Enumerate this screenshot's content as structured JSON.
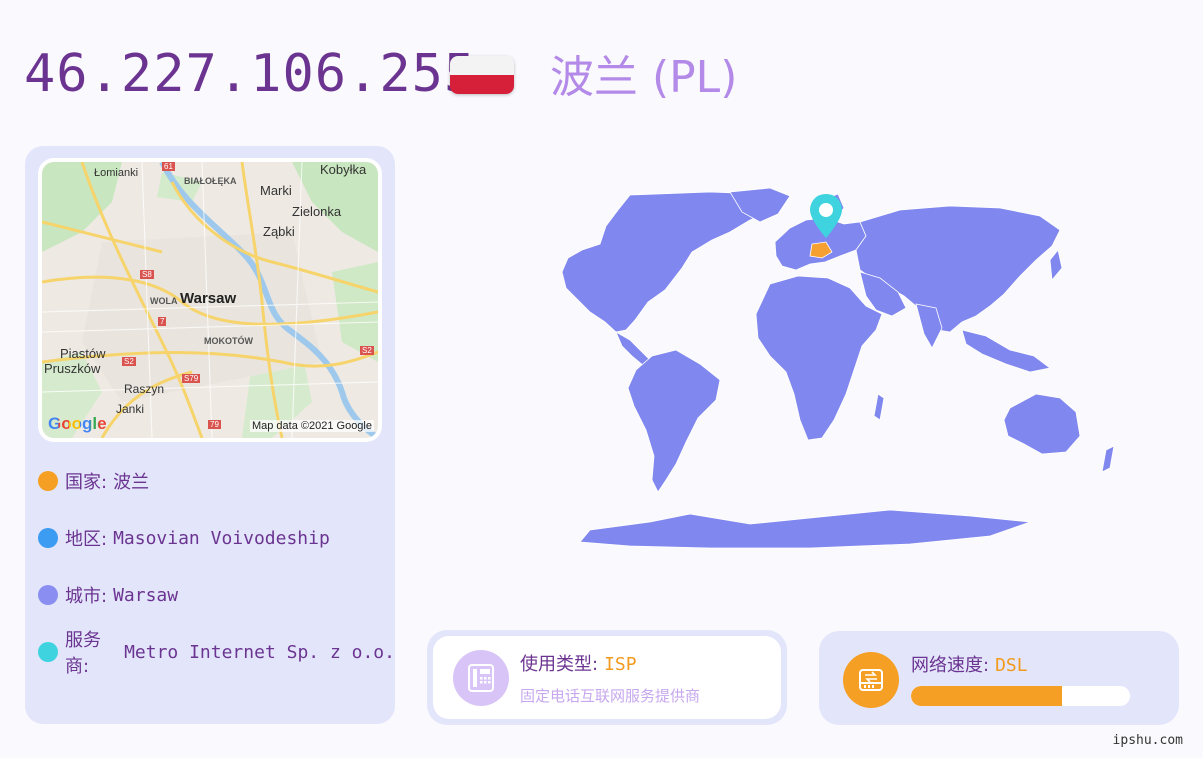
{
  "header": {
    "ip": "46.227.106.255",
    "country": "波兰 (PL)"
  },
  "flag": {
    "colors": [
      "#f3f3f3",
      "#d6203a"
    ]
  },
  "map": {
    "labels": {
      "lomianki": "Łomianki",
      "kobylka": "Kobyłka",
      "bialoleka": "BIAŁOŁĘKA",
      "marki": "Marki",
      "zielonka": "Zielonka",
      "zabki": "Ząbki",
      "wola": "WOLA",
      "warsaw": "Warsaw",
      "mokotow": "MOKOTÓW",
      "piastow": "Piastów",
      "pruszkow": "Pruszków",
      "raszyn": "Raszyn",
      "janki": "Janki"
    },
    "road_badges": [
      "61",
      "S8",
      "7",
      "S2",
      "S79",
      "S2",
      "79"
    ],
    "google_logo": "Google",
    "attribution": "Map data ©2021 Google"
  },
  "info": [
    {
      "label": "国家:",
      "value": "波兰",
      "color": "#f59f25"
    },
    {
      "label": "地区:",
      "value": "Masovian Voivodeship",
      "color": "#3b9cf2"
    },
    {
      "label": "城市:",
      "value": "Warsaw",
      "color": "#8a8ef0"
    },
    {
      "label": "服务商:",
      "value": "Metro Internet Sp. z o.o.",
      "color": "#3fd3e0"
    }
  ],
  "world": {
    "land_color": "#8087ee",
    "highlight_color": "#f5a030",
    "pin_color": "#3fd3e0"
  },
  "isp_card": {
    "title_key": "使用类型:",
    "title_value": "ISP",
    "subtitle": "固定电话互联网服务提供商",
    "icon": "phone-icon",
    "icon_bg": "#d8c4f7"
  },
  "speed_card": {
    "title_key": "网络速度:",
    "title_value": "DSL",
    "progress_fraction": 0.69,
    "icon": "router-icon",
    "icon_bg": "#f59f25"
  },
  "watermark": "ipshu.com"
}
